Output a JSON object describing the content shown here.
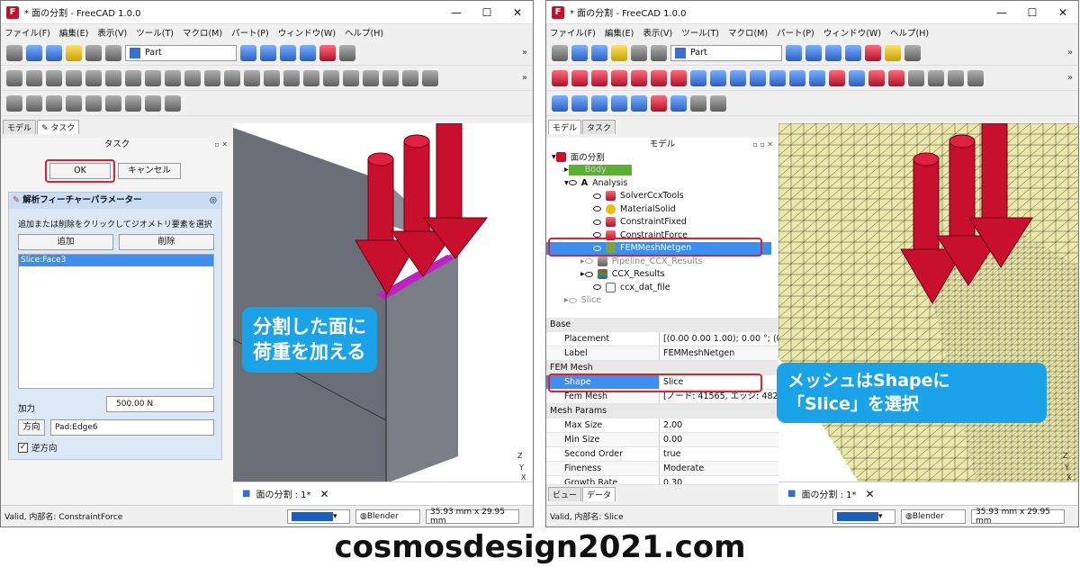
{
  "left": {
    "title": "* 面の分割 - FreeCAD 1.0.0",
    "menus": [
      "ファイル(F)",
      "編集(E)",
      "表示(V)",
      "ツール(T)",
      "マクロ(M)",
      "パート(P)",
      "ウィンドウ(W)",
      "ヘルプ(H)"
    ],
    "workbench": "Part",
    "tabs": [
      "モデル",
      "タスク"
    ],
    "task_header": "タスク",
    "ok_label": "OK",
    "cancel_label": "キャンセル",
    "panel_title": "解析フィーチャーパラメーター",
    "instruction": "追加または削除をクリックしてジオメトリ要素を選択",
    "add_label": "追加",
    "remove_label": "削除",
    "selected_item": "Slice:Face3",
    "force_label": "加力",
    "force_value": "500.00 N",
    "direction_button": "方向",
    "direction_value": "Pad:Edge6",
    "reverse_label": "逆方向",
    "callout": [
      "分割した面に",
      "荷重を加える"
    ],
    "doc_tab": "面の分割 : 1*",
    "status_text": "Valid, 内部名: ConstraintForce",
    "nav_style": "Blender",
    "dims": "35.93 mm x 29.95 mm"
  },
  "right": {
    "title": "* 面の分割 - FreeCAD 1.0.0",
    "menus": [
      "ファイル(F)",
      "編集(E)",
      "表示(V)",
      "ツール(T)",
      "マクロ(M)",
      "パート(P)",
      "ウィンドウ(W)",
      "ヘルプ(H)"
    ],
    "workbench": "Part",
    "tabs": [
      "モデル",
      "タスク"
    ],
    "model_header": "モデル",
    "tree": [
      "面の分割",
      "Body",
      "Analysis",
      "SolverCcxTools",
      "MaterialSolid",
      "ConstraintFixed",
      "ConstraintForce",
      "FEMMeshNetgen",
      "Pipeline_CCX_Results",
      "CCX_Results",
      "ccx_dat_file",
      "Slice"
    ],
    "props": {
      "base": "Base",
      "placement_k": "Placement",
      "placement_v": "[(0.00 0.00 1.00); 0.00 °; (0....",
      "label_k": "Label",
      "label_v": "FEMMeshNetgen",
      "femmesh": "FEM Mesh",
      "shape_k": "Shape",
      "shape_v": "Slice",
      "femmesh_k": "Fem Mesh",
      "femmesh_v": "[ノード: 41565, エッジ: 482, ...",
      "meshparams": "Mesh Params",
      "maxsize_k": "Max Size",
      "maxsize_v": "2.00",
      "minsize_k": "Min Size",
      "minsize_v": "0.00",
      "second_k": "Second Order",
      "second_v": "true",
      "fine_k": "Fineness",
      "fine_v": "Moderate",
      "growth_k": "Growth Rate",
      "growth_v": "0.30"
    },
    "bottom_tabs": [
      "ビュー",
      "データ"
    ],
    "callout": [
      "メッシュはShapeに",
      "「Slice」を選択"
    ],
    "doc_tab": "面の分割 : 1*",
    "status_text": "Valid, 内部名: Slice",
    "nav_style": "Blender",
    "dims": "35.93 mm x 29.95 mm"
  },
  "footer": "cosmosdesign2021.com"
}
